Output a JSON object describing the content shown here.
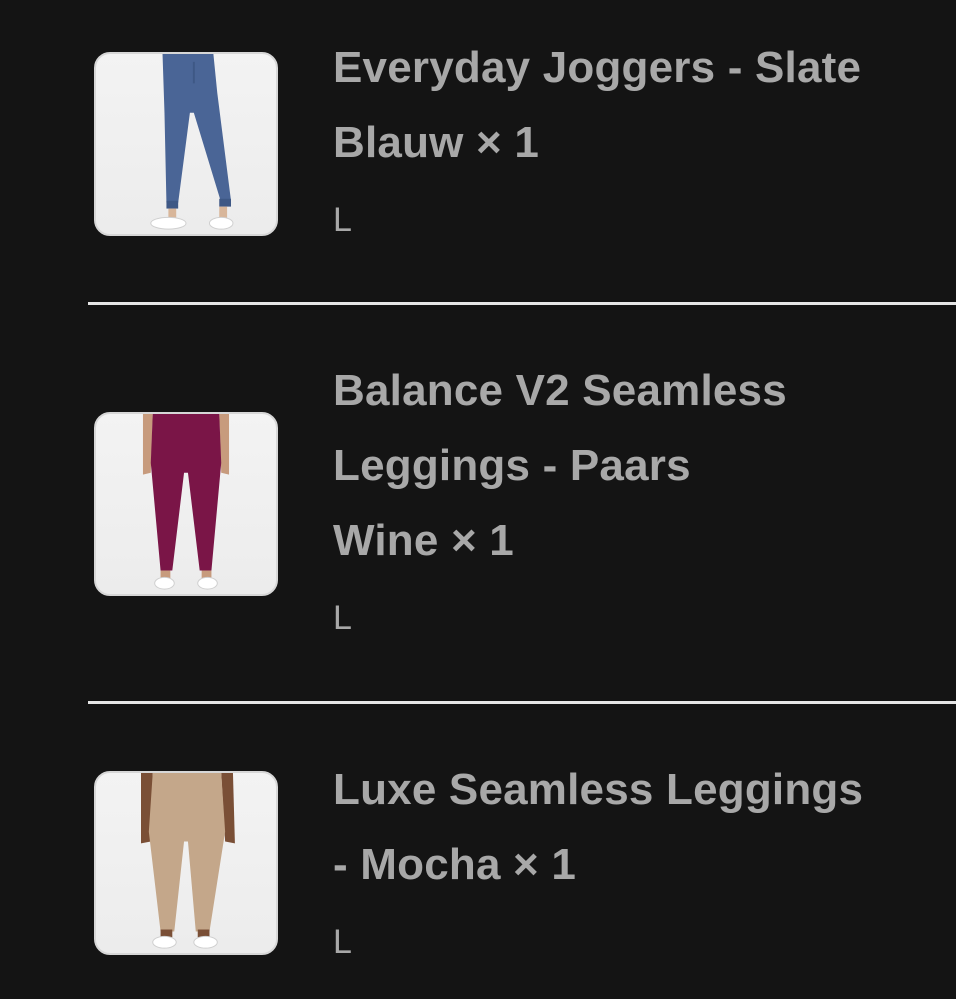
{
  "items": [
    {
      "title_line1": "Everyday Joggers - Slate",
      "title_line2": "Blauw × 1",
      "variant": "L",
      "product_color": "#4a6596",
      "image_icon": "joggers-image"
    },
    {
      "title_line1": "Balance V2 Seamless",
      "title_line2": "Leggings - Paars",
      "title_line3": "Wine × 1",
      "variant": "L",
      "product_color": "#7a1547",
      "image_icon": "leggings-image"
    },
    {
      "title_line1": "Luxe Seamless Leggings",
      "title_line2": "- Mocha × 1",
      "variant": "L",
      "product_color": "#c4a78a",
      "image_icon": "leggings-image"
    }
  ]
}
